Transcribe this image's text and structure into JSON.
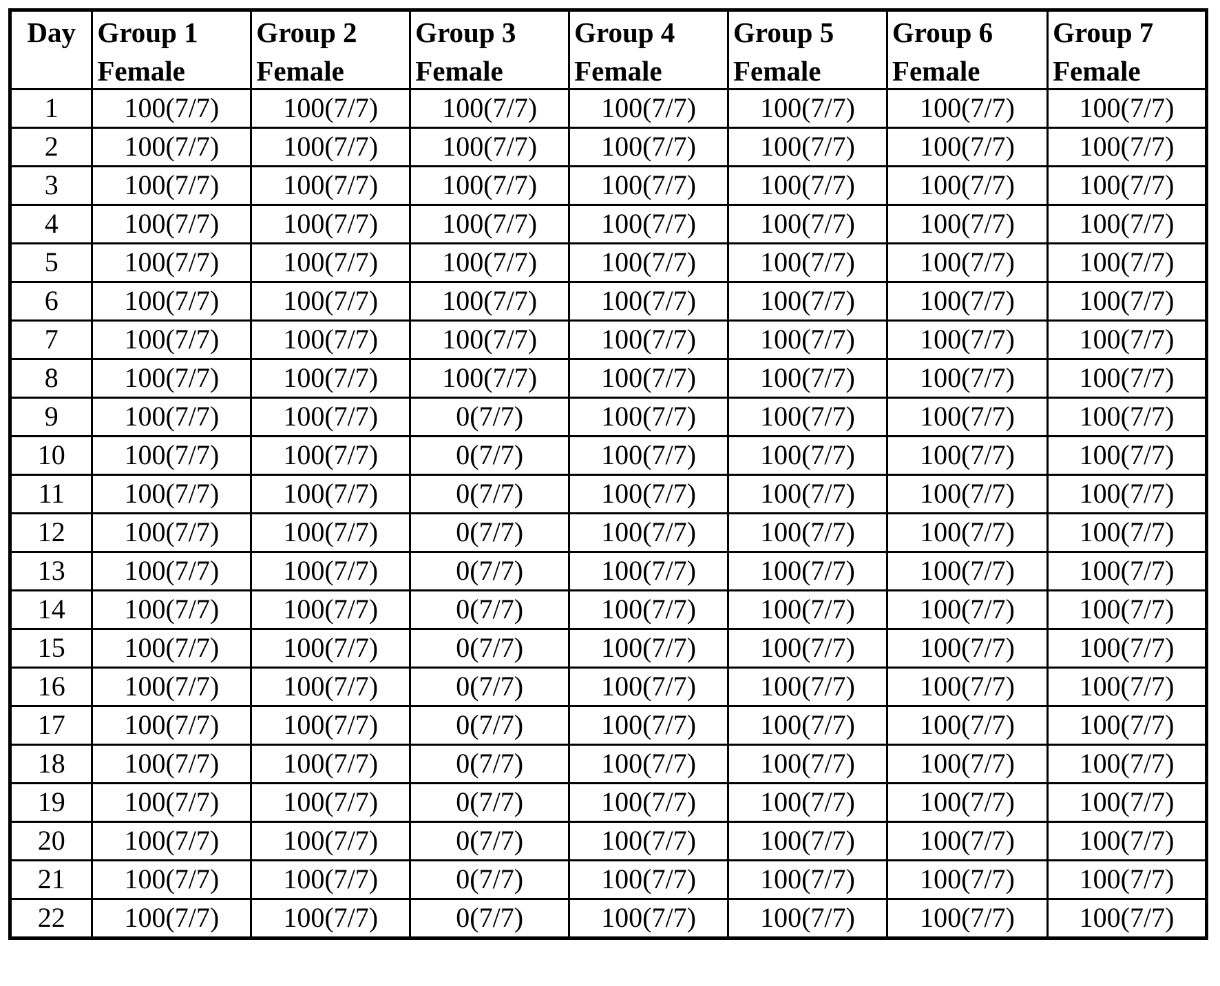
{
  "table": {
    "caption": "",
    "day_header": "Day",
    "columns": [
      {
        "id": "day",
        "line1": "Day",
        "line2": ""
      },
      {
        "id": "group1",
        "line1": "Group 1",
        "line2": "Female"
      },
      {
        "id": "group2",
        "line1": "Group 2",
        "line2": "Female"
      },
      {
        "id": "group3",
        "line1": "Group 3",
        "line2": "Female"
      },
      {
        "id": "group4",
        "line1": "Group 4",
        "line2": "Female"
      },
      {
        "id": "group5",
        "line1": "Group 5",
        "line2": "Female"
      },
      {
        "id": "group6",
        "line1": "Group 6",
        "line2": "Female"
      },
      {
        "id": "group7",
        "line1": "Group 7",
        "line2": "Female"
      }
    ],
    "rows": [
      {
        "day": "1",
        "values": [
          "100(7/7)",
          "100(7/7)",
          "100(7/7)",
          "100(7/7)",
          "100(7/7)",
          "100(7/7)",
          "100(7/7)"
        ]
      },
      {
        "day": "2",
        "values": [
          "100(7/7)",
          "100(7/7)",
          "100(7/7)",
          "100(7/7)",
          "100(7/7)",
          "100(7/7)",
          "100(7/7)"
        ]
      },
      {
        "day": "3",
        "values": [
          "100(7/7)",
          "100(7/7)",
          "100(7/7)",
          "100(7/7)",
          "100(7/7)",
          "100(7/7)",
          "100(7/7)"
        ]
      },
      {
        "day": "4",
        "values": [
          "100(7/7)",
          "100(7/7)",
          "100(7/7)",
          "100(7/7)",
          "100(7/7)",
          "100(7/7)",
          "100(7/7)"
        ]
      },
      {
        "day": "5",
        "values": [
          "100(7/7)",
          "100(7/7)",
          "100(7/7)",
          "100(7/7)",
          "100(7/7)",
          "100(7/7)",
          "100(7/7)"
        ]
      },
      {
        "day": "6",
        "values": [
          "100(7/7)",
          "100(7/7)",
          "100(7/7)",
          "100(7/7)",
          "100(7/7)",
          "100(7/7)",
          "100(7/7)"
        ]
      },
      {
        "day": "7",
        "values": [
          "100(7/7)",
          "100(7/7)",
          "100(7/7)",
          "100(7/7)",
          "100(7/7)",
          "100(7/7)",
          "100(7/7)"
        ]
      },
      {
        "day": "8",
        "values": [
          "100(7/7)",
          "100(7/7)",
          "100(7/7)",
          "100(7/7)",
          "100(7/7)",
          "100(7/7)",
          "100(7/7)"
        ]
      },
      {
        "day": "9",
        "values": [
          "100(7/7)",
          "100(7/7)",
          "0(7/7)",
          "100(7/7)",
          "100(7/7)",
          "100(7/7)",
          "100(7/7)"
        ]
      },
      {
        "day": "10",
        "values": [
          "100(7/7)",
          "100(7/7)",
          "0(7/7)",
          "100(7/7)",
          "100(7/7)",
          "100(7/7)",
          "100(7/7)"
        ]
      },
      {
        "day": "11",
        "values": [
          "100(7/7)",
          "100(7/7)",
          "0(7/7)",
          "100(7/7)",
          "100(7/7)",
          "100(7/7)",
          "100(7/7)"
        ]
      },
      {
        "day": "12",
        "values": [
          "100(7/7)",
          "100(7/7)",
          "0(7/7)",
          "100(7/7)",
          "100(7/7)",
          "100(7/7)",
          "100(7/7)"
        ]
      },
      {
        "day": "13",
        "values": [
          "100(7/7)",
          "100(7/7)",
          "0(7/7)",
          "100(7/7)",
          "100(7/7)",
          "100(7/7)",
          "100(7/7)"
        ]
      },
      {
        "day": "14",
        "values": [
          "100(7/7)",
          "100(7/7)",
          "0(7/7)",
          "100(7/7)",
          "100(7/7)",
          "100(7/7)",
          "100(7/7)"
        ]
      },
      {
        "day": "15",
        "values": [
          "100(7/7)",
          "100(7/7)",
          "0(7/7)",
          "100(7/7)",
          "100(7/7)",
          "100(7/7)",
          "100(7/7)"
        ]
      },
      {
        "day": "16",
        "values": [
          "100(7/7)",
          "100(7/7)",
          "0(7/7)",
          "100(7/7)",
          "100(7/7)",
          "100(7/7)",
          "100(7/7)"
        ]
      },
      {
        "day": "17",
        "values": [
          "100(7/7)",
          "100(7/7)",
          "0(7/7)",
          "100(7/7)",
          "100(7/7)",
          "100(7/7)",
          "100(7/7)"
        ]
      },
      {
        "day": "18",
        "values": [
          "100(7/7)",
          "100(7/7)",
          "0(7/7)",
          "100(7/7)",
          "100(7/7)",
          "100(7/7)",
          "100(7/7)"
        ]
      },
      {
        "day": "19",
        "values": [
          "100(7/7)",
          "100(7/7)",
          "0(7/7)",
          "100(7/7)",
          "100(7/7)",
          "100(7/7)",
          "100(7/7)"
        ]
      },
      {
        "day": "20",
        "values": [
          "100(7/7)",
          "100(7/7)",
          "0(7/7)",
          "100(7/7)",
          "100(7/7)",
          "100(7/7)",
          "100(7/7)"
        ]
      },
      {
        "day": "21",
        "values": [
          "100(7/7)",
          "100(7/7)",
          "0(7/7)",
          "100(7/7)",
          "100(7/7)",
          "100(7/7)",
          "100(7/7)"
        ]
      },
      {
        "day": "22",
        "values": [
          "100(7/7)",
          "100(7/7)",
          "0(7/7)",
          "100(7/7)",
          "100(7/7)",
          "100(7/7)",
          "100(7/7)"
        ]
      }
    ]
  },
  "colors": {
    "border": "#000000",
    "text": "#000000",
    "background": "#ffffff"
  }
}
